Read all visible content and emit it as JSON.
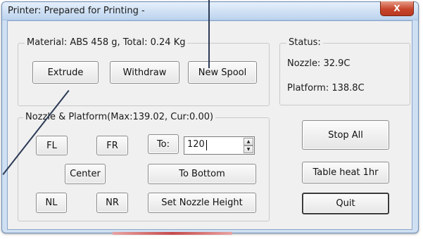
{
  "window": {
    "title": "Printer: Prepared for Printing -",
    "close_glyph": "X"
  },
  "material_group": {
    "label": "Material: ABS 458 g,  Total: 0.24 Kg",
    "buttons": {
      "extrude": "Extrude",
      "withdraw": "Withdraw",
      "new_spool": "New Spool"
    }
  },
  "status_group": {
    "label": "Status:",
    "nozzle": "Nozzle: 32.9C",
    "platform": "Platform: 138.8C"
  },
  "nozzle_platform_group": {
    "label": "Nozzle & Platform(Max:139.02, Cur:0.00)",
    "buttons": {
      "fl": "FL",
      "fr": "FR",
      "to": "To:",
      "center": "Center",
      "to_bottom": "To Bottom",
      "nl": "NL",
      "nr": "NR",
      "set_nozzle_height": "Set Nozzle Height"
    },
    "height_input_value": "120"
  },
  "right_buttons": {
    "stop_all": "Stop All",
    "table_heat": "Table heat 1hr",
    "quit": "Quit"
  },
  "icons": {
    "close": "close-icon",
    "spin_up": "chevron-up-icon",
    "spin_down": "chevron-down-icon"
  },
  "colors": {
    "title_bar": "#bcd3ee",
    "client_bg": "#f0f0f0",
    "close_button": "#c8452c",
    "pointer_line": "#2c3a55"
  }
}
